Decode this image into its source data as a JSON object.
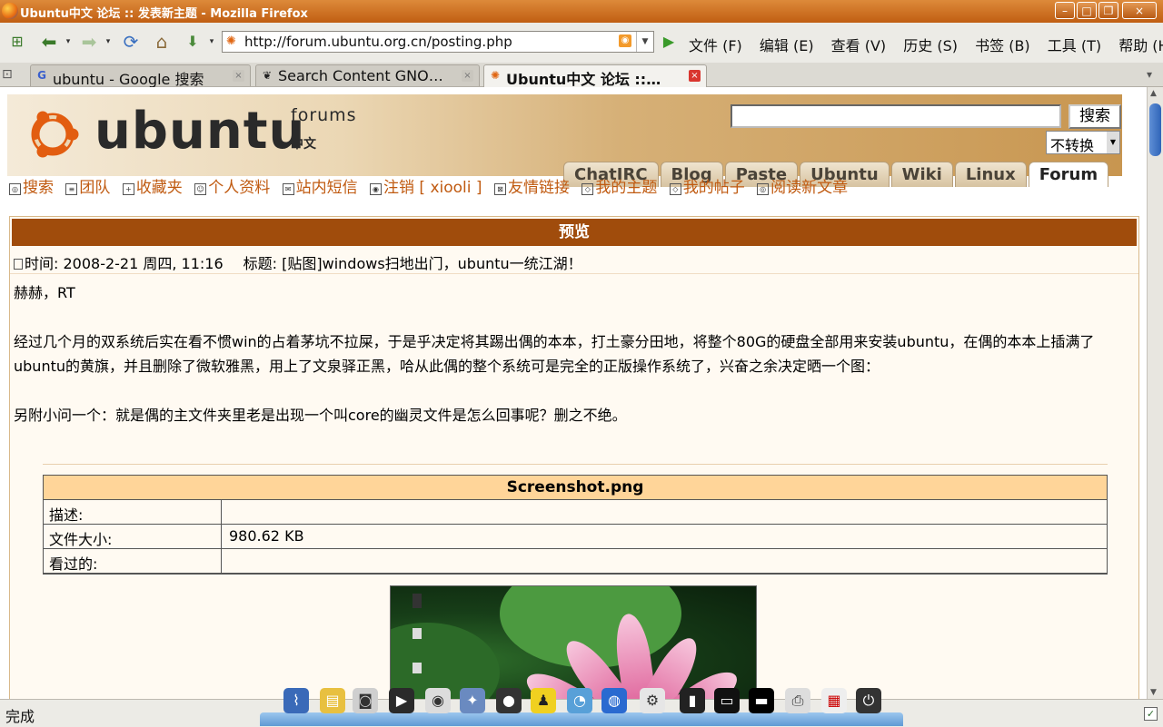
{
  "window": {
    "title": "Ubuntu中文 论坛 :: 发表新主题 - Mozilla Firefox",
    "min_label": "–",
    "max_label": "□",
    "close_label": "×"
  },
  "toolbar": {
    "url": "http://forum.ubuntu.org.cn/posting.php",
    "go_label": "▶",
    "menu": [
      "文件 (F)",
      "编辑 (E)",
      "查看 (V)",
      "历史 (S)",
      "书签 (B)",
      "工具 (T)",
      "帮助 (H)"
    ]
  },
  "tabs": [
    {
      "label": "ubuntu - Google 搜索",
      "icon": "google-icon"
    },
    {
      "label": "Search Content GNO…",
      "icon": "gnome-icon"
    },
    {
      "label": "Ubuntu中文 论坛 ::…",
      "icon": "ubuntu-icon",
      "active": true
    }
  ],
  "forum": {
    "brand": "ubuntu",
    "brand_sub": "forums",
    "brand_cn": "中文",
    "search_button": "搜索",
    "convert_value": "不转换",
    "nav_tabs": [
      "ChatIRC",
      "Blog",
      "Paste",
      "Ubuntu",
      "Wiki",
      "Linux",
      "Forum"
    ],
    "links": [
      "搜索",
      "团队",
      "收藏夹",
      "个人资料",
      "站内短信",
      "注销 [ xiooli ]",
      "友情链接",
      "我的主题",
      "我的帖子",
      "阅读新文章"
    ]
  },
  "preview": {
    "heading": "预览",
    "time": "时间: 2008-2-21 周四, 11:16",
    "subject": "标题: [贴图]windows扫地出门，ubuntu一统江湖！",
    "paragraphs": [
      "赫赫，RT",
      "经过几个月的双系统后实在看不惯win的占着茅坑不拉屎，于是乎决定将其踢出偶的本本，打土豪分田地，将整个80G的硬盘全部用来安装ubuntu，在偶的本本上插满了ubuntu的黄旗，并且删除了微软雅黑，用上了文泉驿正黑，哈从此偶的整个系统可是完全的正版操作系统了，兴奋之余决定晒一个图：",
      "另附小问一个：就是偶的主文件夹里老是出现一个叫core的幽灵文件是怎么回事呢？删之不绝。"
    ],
    "attachment": {
      "filename": "Screenshot.png",
      "desc_label": "描述:",
      "desc_value": "",
      "size_label": "文件大小:",
      "size_value": "980.62 KB",
      "views_label": "看过的:",
      "views_value": ""
    }
  },
  "status": {
    "text": "完成"
  },
  "colors": {
    "titlebar": "#c86a1e",
    "preview_header": "#a04c0c",
    "link": "#c05a10",
    "attachment_header": "#ffd599"
  }
}
